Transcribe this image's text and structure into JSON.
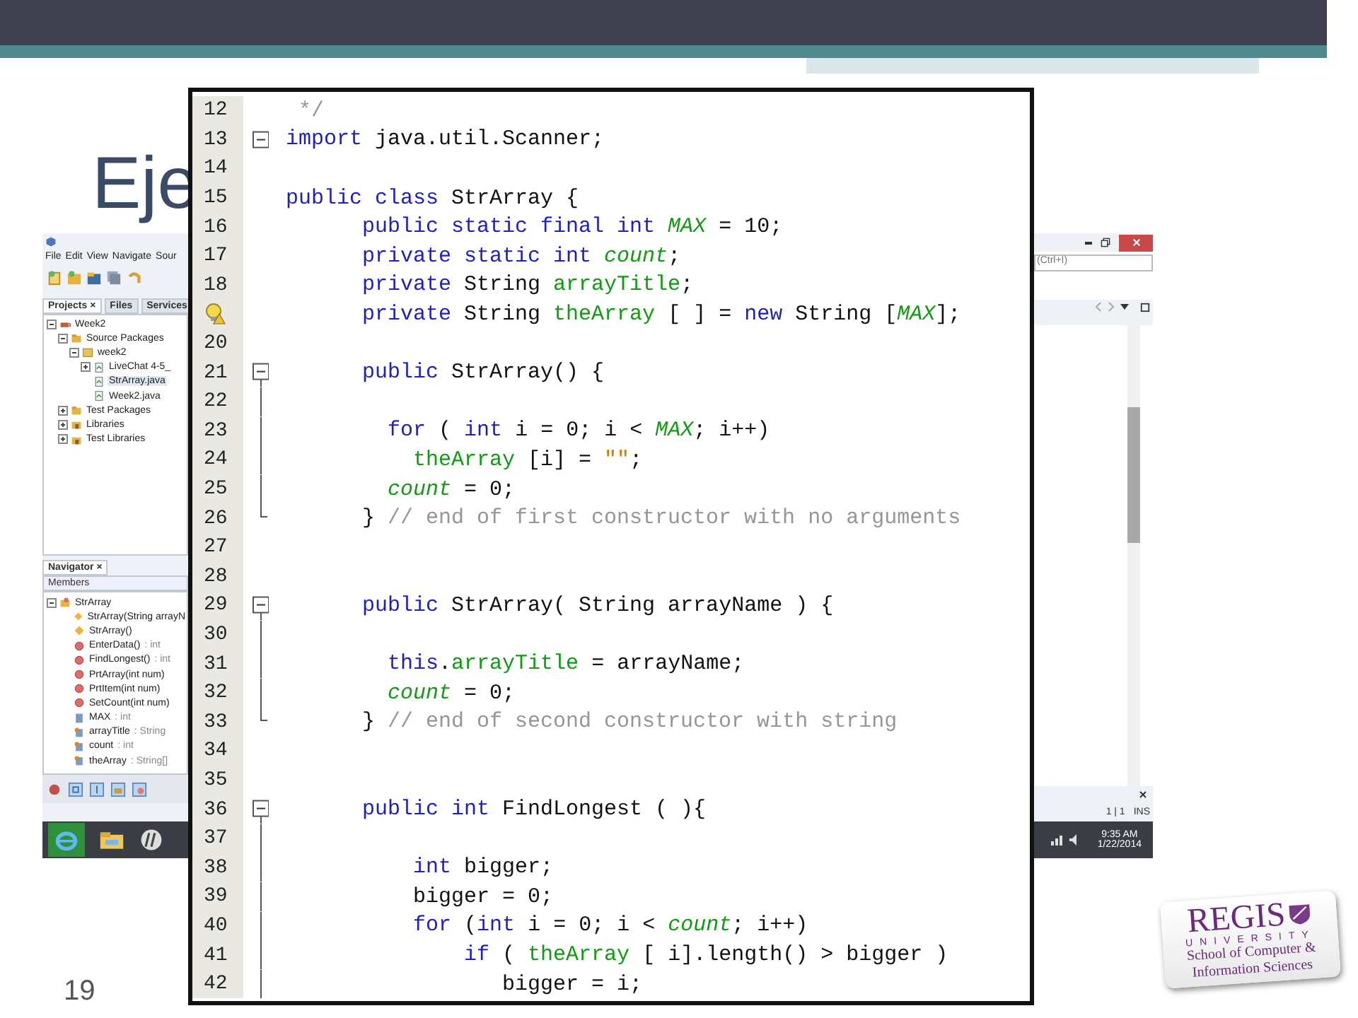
{
  "slide": {
    "title": "Eje",
    "page_number": "19"
  },
  "ide": {
    "menu": [
      "File",
      "Edit",
      "View",
      "Navigate",
      "Sour"
    ],
    "search_hint": "(Ctrl+I)",
    "project_tabs": [
      {
        "label": "Projects ×",
        "selected": true
      },
      {
        "label": "Files",
        "selected": false
      },
      {
        "label": "Services",
        "selected": false
      }
    ],
    "project_tree": [
      {
        "label": "Week2",
        "kind": "project",
        "expanded": true,
        "selected": false,
        "children": [
          {
            "label": "Source Packages",
            "kind": "packages",
            "expanded": true,
            "selected": false,
            "children": [
              {
                "label": "week2",
                "kind": "package",
                "expanded": true,
                "selected": false,
                "children": [
                  {
                    "label": "LiveChat 4-5_",
                    "kind": "javafile",
                    "expanded": false,
                    "selected": false
                  },
                  {
                    "label": "StrArray.java",
                    "kind": "javafile",
                    "selected": true
                  },
                  {
                    "label": "Week2.java",
                    "kind": "javafile",
                    "selected": false
                  }
                ]
              }
            ]
          },
          {
            "label": "Test Packages",
            "kind": "packages",
            "expanded": false,
            "selected": false
          },
          {
            "label": "Libraries",
            "kind": "library",
            "expanded": false,
            "selected": false
          },
          {
            "label": "Test Libraries",
            "kind": "library",
            "expanded": false,
            "selected": false
          }
        ]
      }
    ],
    "navigator": {
      "title": "Navigator ×",
      "filter": "Members",
      "tree": [
        {
          "label": "StrArray",
          "kind": "class",
          "expanded": true,
          "children": [
            {
              "label": "StrArray(String arrayN",
              "kind": "constructor"
            },
            {
              "label": "StrArray()",
              "kind": "constructor"
            },
            {
              "label": "EnterData()",
              "type": ": int",
              "kind": "method"
            },
            {
              "label": "FindLongest()",
              "type": ": int",
              "kind": "method"
            },
            {
              "label": "PrtArray(int num)",
              "kind": "method"
            },
            {
              "label": "PrtItem(int num)",
              "kind": "method"
            },
            {
              "label": "SetCount(int num)",
              "kind": "method"
            },
            {
              "label": "MAX",
              "type": ": int",
              "kind": "constant"
            },
            {
              "label": "arrayTitle",
              "type": ": String",
              "kind": "field"
            },
            {
              "label": "count",
              "type": ": int",
              "kind": "field"
            },
            {
              "label": "theArray",
              "type": ": String[]",
              "kind": "field"
            }
          ]
        }
      ]
    },
    "status": {
      "position": "1 | 1",
      "mode": "INS"
    },
    "clock": {
      "time": "9:35 AM",
      "date": "1/22/2014"
    }
  },
  "editor": {
    "lines": [
      {
        "number": "12",
        "kind": "plain",
        "tokens": [
          {
            "kind": "comment",
            "text": " */"
          }
        ]
      },
      {
        "number": "13",
        "kind": "fold",
        "tokens": [
          {
            "kind": "keyword",
            "text": "import"
          },
          {
            "kind": "plain",
            "text": " java.util.Scanner;"
          }
        ]
      },
      {
        "number": "14",
        "kind": "plain"
      },
      {
        "number": "15",
        "kind": "plain",
        "tokens": [
          {
            "kind": "keyword",
            "text": "public class"
          },
          {
            "kind": "plain",
            "text": " StrArray {"
          }
        ]
      },
      {
        "number": "16",
        "kind": "plain",
        "tokens": [
          {
            "kind": "keyword",
            "text": "      public static final int "
          },
          {
            "kind": "static",
            "text": "MAX"
          },
          {
            "kind": "plain",
            "text": " = 10;"
          }
        ]
      },
      {
        "number": "17",
        "kind": "plain",
        "tokens": [
          {
            "kind": "keyword",
            "text": "      private static int "
          },
          {
            "kind": "static",
            "text": "count"
          },
          {
            "kind": "plain",
            "text": ";"
          }
        ]
      },
      {
        "number": "18",
        "kind": "plain",
        "tokens": [
          {
            "kind": "keyword",
            "text": "      private"
          },
          {
            "kind": "plain",
            "text": " String "
          },
          {
            "kind": "field",
            "text": "arrayTitle"
          },
          {
            "kind": "plain",
            "text": ";"
          }
        ]
      },
      {
        "kind": "warning",
        "tokens": [
          {
            "kind": "keyword",
            "text": "      private"
          },
          {
            "kind": "plain",
            "text": " String "
          },
          {
            "kind": "field",
            "text": "theArray"
          },
          {
            "kind": "plain",
            "text": " [ ] = "
          },
          {
            "kind": "keyword",
            "text": "new"
          },
          {
            "kind": "plain",
            "text": " String ["
          },
          {
            "kind": "static",
            "text": "MAX"
          },
          {
            "kind": "plain",
            "text": "];"
          }
        ]
      },
      {
        "number": "20",
        "kind": "plain"
      },
      {
        "number": "21",
        "kind": "fold",
        "tokens": [
          {
            "kind": "keyword",
            "text": "      public"
          },
          {
            "kind": "plain",
            "text": " StrArray() {"
          }
        ]
      },
      {
        "number": "22",
        "kind": "line"
      },
      {
        "number": "23",
        "kind": "line",
        "tokens": [
          {
            "kind": "keyword",
            "text": "        for"
          },
          {
            "kind": "plain",
            "text": " ( "
          },
          {
            "kind": "keyword",
            "text": "int"
          },
          {
            "kind": "plain",
            "text": " i = 0; i < "
          },
          {
            "kind": "static",
            "text": "MAX"
          },
          {
            "kind": "plain",
            "text": "; i++)"
          }
        ]
      },
      {
        "number": "24",
        "kind": "line",
        "tokens": [
          {
            "kind": "field",
            "text": "          theArray"
          },
          {
            "kind": "plain",
            "text": " [i] = "
          },
          {
            "kind": "string",
            "text": "\"\""
          },
          {
            "kind": "plain",
            "text": ";"
          }
        ]
      },
      {
        "number": "25",
        "kind": "line",
        "tokens": [
          {
            "kind": "static",
            "text": "        count"
          },
          {
            "kind": "plain",
            "text": " = 0;"
          }
        ]
      },
      {
        "number": "26",
        "kind": "end",
        "tokens": [
          {
            "kind": "plain",
            "text": "      } "
          },
          {
            "kind": "comment",
            "text": "// end of first constructor with no arguments"
          }
        ]
      },
      {
        "number": "27",
        "kind": "plain"
      },
      {
        "number": "28",
        "kind": "plain"
      },
      {
        "number": "29",
        "kind": "fold",
        "tokens": [
          {
            "kind": "keyword",
            "text": "      public"
          },
          {
            "kind": "plain",
            "text": " StrArray( String arrayName ) {"
          }
        ]
      },
      {
        "number": "30",
        "kind": "line"
      },
      {
        "number": "31",
        "kind": "line",
        "tokens": [
          {
            "kind": "keyword",
            "text": "        this"
          },
          {
            "kind": "plain",
            "text": "."
          },
          {
            "kind": "field",
            "text": "arrayTitle"
          },
          {
            "kind": "plain",
            "text": " = arrayName;"
          }
        ]
      },
      {
        "number": "32",
        "kind": "line",
        "tokens": [
          {
            "kind": "static",
            "text": "        count"
          },
          {
            "kind": "plain",
            "text": " = 0;"
          }
        ]
      },
      {
        "number": "33",
        "kind": "end",
        "tokens": [
          {
            "kind": "plain",
            "text": "      } "
          },
          {
            "kind": "comment",
            "text": "// end of second constructor with string"
          }
        ]
      },
      {
        "number": "34",
        "kind": "plain"
      },
      {
        "number": "35",
        "kind": "plain"
      },
      {
        "number": "36",
        "kind": "fold",
        "tokens": [
          {
            "kind": "keyword",
            "text": "      public int"
          },
          {
            "kind": "plain",
            "text": " FindLongest ( ){"
          }
        ]
      },
      {
        "number": "37",
        "kind": "line"
      },
      {
        "number": "38",
        "kind": "line",
        "tokens": [
          {
            "kind": "keyword",
            "text": "          int"
          },
          {
            "kind": "plain",
            "text": " bigger;"
          }
        ]
      },
      {
        "number": "39",
        "kind": "line",
        "tokens": [
          {
            "kind": "plain",
            "text": "          bigger = 0;"
          }
        ]
      },
      {
        "number": "40",
        "kind": "line",
        "tokens": [
          {
            "kind": "keyword",
            "text": "          for"
          },
          {
            "kind": "plain",
            "text": " ("
          },
          {
            "kind": "keyword",
            "text": "int"
          },
          {
            "kind": "plain",
            "text": " i = 0; i < "
          },
          {
            "kind": "static",
            "text": "count"
          },
          {
            "kind": "plain",
            "text": "; i++)"
          }
        ]
      },
      {
        "number": "41",
        "kind": "line",
        "tokens": [
          {
            "kind": "keyword",
            "text": "              if"
          },
          {
            "kind": "plain",
            "text": " ( "
          },
          {
            "kind": "field",
            "text": "theArray"
          },
          {
            "kind": "plain",
            "text": " [ i].length() > bigger )"
          }
        ]
      },
      {
        "number": "42",
        "kind": "line",
        "tokens": [
          {
            "kind": "plain",
            "text": "                 bigger = i;"
          }
        ]
      }
    ]
  },
  "logo": {
    "name": "REGIS",
    "subtitle": "UNIVERSITY",
    "school": "School of Computer &",
    "school_2": "Information Sciences"
  }
}
